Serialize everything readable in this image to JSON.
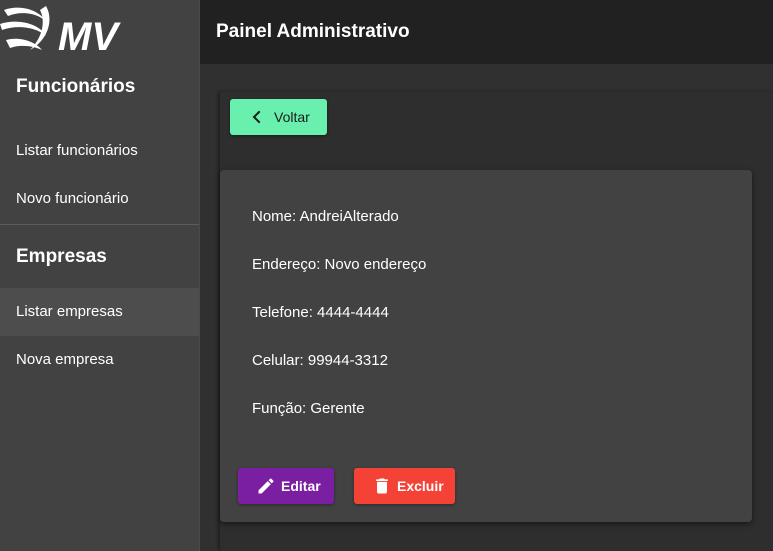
{
  "brand": {
    "logo_text": "MV"
  },
  "appbar": {
    "title": "Painel Administrativo"
  },
  "sidebar": {
    "sections": [
      {
        "title": "Funcionários",
        "items": [
          {
            "label": "Listar funcionários"
          },
          {
            "label": "Novo funcionário"
          }
        ]
      },
      {
        "title": "Empresas",
        "items": [
          {
            "label": "Listar empresas",
            "active": true
          },
          {
            "label": "Nova empresa"
          }
        ]
      }
    ]
  },
  "actions": {
    "back_label": "Voltar"
  },
  "details": {
    "fields": [
      {
        "text": "Nome: AndreiAlterado"
      },
      {
        "text": "Endereço: Novo endereço"
      },
      {
        "text": "Telefone: 4444-4444"
      },
      {
        "text": "Celular: 99944-3312"
      },
      {
        "text": "Função: Gerente"
      }
    ],
    "edit_label": "Editar",
    "delete_label": "Excluir"
  },
  "colors": {
    "back_button": "#69f0ae",
    "edit_button": "#7b1fa2",
    "delete_button": "#f44336",
    "sidebar_bg": "#424242",
    "appbar_bg": "#212121"
  },
  "icons": {
    "back": "chevron-left-icon",
    "edit": "pencil-icon",
    "delete": "trash-icon"
  }
}
